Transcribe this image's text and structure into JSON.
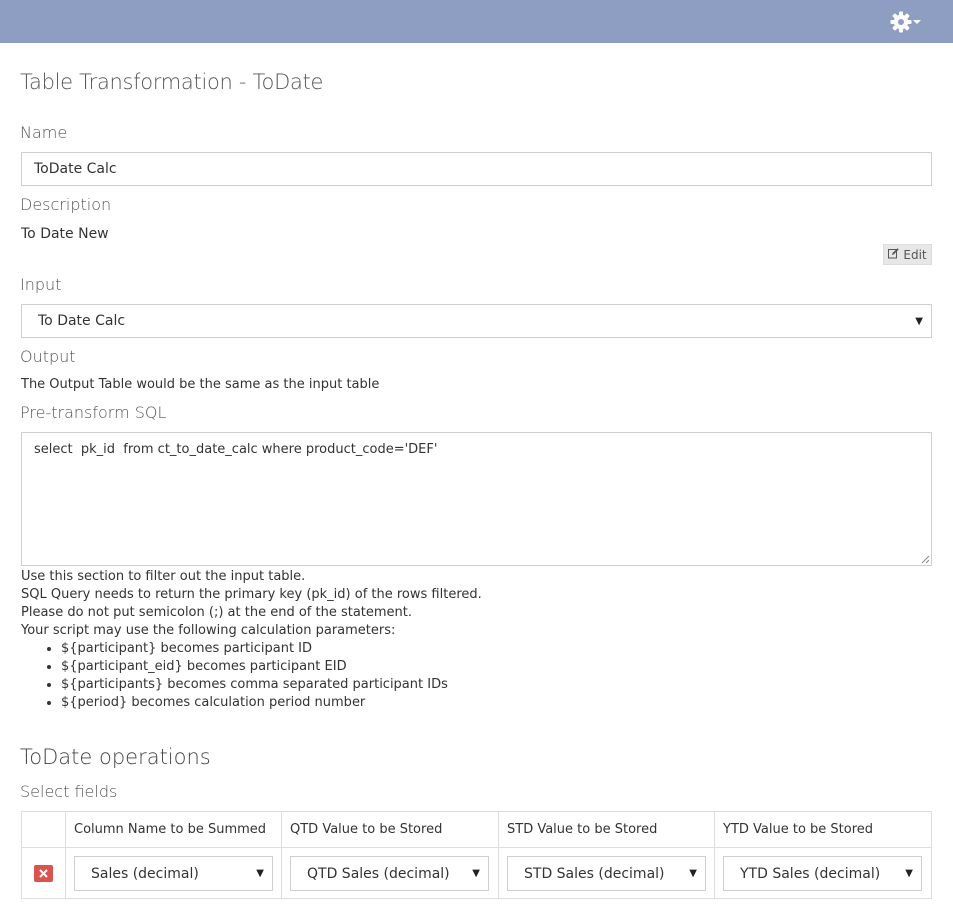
{
  "topbar": {
    "settings_icon": "gear-icon",
    "menu_caret_icon": "caret-down-icon"
  },
  "page_title": "Table Transformation - ToDate",
  "name": {
    "label": "Name",
    "value": "ToDate Calc"
  },
  "description": {
    "label": "Description",
    "value": "To Date New",
    "edit_label": "Edit",
    "edit_icon": "edit-icon"
  },
  "input": {
    "label": "Input",
    "selected": "To Date Calc"
  },
  "output": {
    "label": "Output",
    "text": "The Output Table would be the same as the input table"
  },
  "pre_sql": {
    "label": "Pre-transform SQL",
    "value": "select  pk_id  from ct_to_date_calc where product_code='DEF'",
    "help_lines": [
      "Use this section to filter out the input table.",
      "SQL Query needs to return the primary key (pk_id) of the rows filtered.",
      "Please do not put semicolon (;) at the end of the statement.",
      "Your script may use the following calculation parameters:"
    ],
    "params": [
      "${participant} becomes participant ID",
      "${participant_eid} becomes participant EID",
      "${participants} becomes comma separated participant IDs",
      "${period} becomes calculation period number"
    ]
  },
  "operations": {
    "title": "ToDate operations",
    "subtitle": "Select fields",
    "columns": [
      "Column Name to be Summed",
      "QTD Value to be Stored",
      "STD Value to be Stored",
      "YTD Value to be Stored"
    ],
    "rows": [
      {
        "sum_column": "Sales (decimal)",
        "qtd": "QTD Sales (decimal)",
        "std": "STD Sales (decimal)",
        "ytd": "YTD Sales (decimal)"
      }
    ]
  }
}
